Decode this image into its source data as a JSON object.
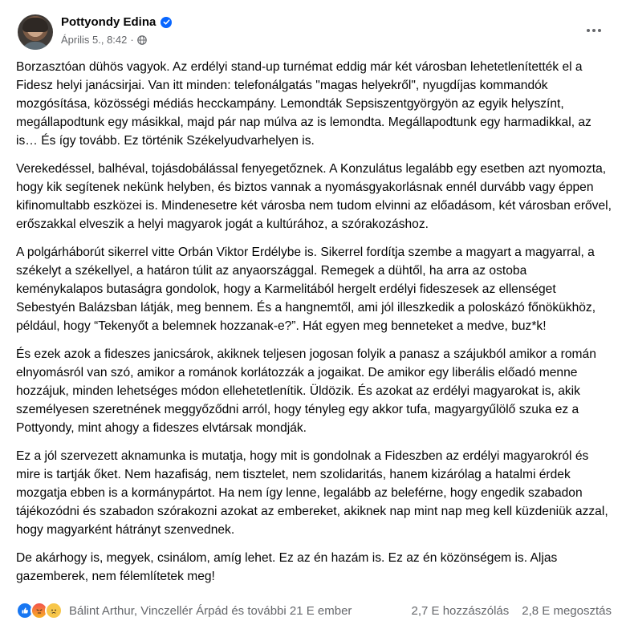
{
  "post": {
    "author": "Pottyondy Edina",
    "date": "Április 5., 8:42",
    "separator": "·",
    "paragraphs": [
      "Borzasztóan dühös vagyok. Az erdélyi stand-up turnémat eddig már két városban lehetetlenítették el a Fidesz helyi janácsirjai. Van itt minden: telefonálgatás \"magas helyekről\", nyugdíjas kommandók mozgósítása, közösségi médiás hecckampány. Lemondták Sepsiszentgyörgyön az egyik helyszínt, megállapodtunk egy másikkal, majd pár nap múlva az is lemondta. Megállapodtunk egy harmadikkal, az is… És így tovább. Ez történik Székelyudvarhelyen is.",
      "Verekedéssel, balhéval, tojásdobálással fenyegetőznek. A Konzulátus legalább egy esetben azt nyomozta, hogy kik segítenek nekünk helyben, és biztos vannak a nyomásgyakorlásnak ennél durvább vagy éppen kifinomultabb eszközei is. Mindenesetre két városba nem tudom elvinni az előadásom, két városban erővel, erőszakkal elveszik a helyi magyarok jogát a kultúrához, a szórakozáshoz.",
      "A polgárháborút sikerrel vitte Orbán Viktor Erdélybe is. Sikerrel fordítja szembe a magyart a magyarral, a székelyt a székellyel, a határon túlit az anyaországgal. Remegek a dühtől, ha arra az ostoba keménykalapos butaságra gondolok, hogy a Karmelitából hergelt erdélyi fideszesek az ellenséget Sebestyén Balázsban látják, meg bennem. És a hangnemtől, ami jól illeszkedik a poloskázó főnökükhöz, például, hogy “Tekenyőt a belemnek hozzanak-e?”. Hát egyen meg benneteket a medve, buz*k!",
      "És ezek azok a fideszes janicsárok, akiknek teljesen jogosan folyik a panasz a szájukból amikor a román elnyomásról van szó, amikor a románok korlátozzák a jogaikat. De amikor egy liberális előadó menne hozzájuk, minden lehetséges módon ellehetetlenítik. Üldözik. És azokat az erdélyi magyarokat is, akik személyesen szeretnének meggyőződni arról, hogy tényleg egy akkor tufa, magyargyűlölő szuka ez a Pottyondy, mint ahogy a fideszes elvtársak mondják.",
      "Ez a jól szervezett aknamunka is mutatja, hogy mit is gondolnak a Fideszben az erdélyi magyarokról és mire is tartják őket. Nem hazafiság, nem tisztelet, nem szolidaritás, hanem kizárólag a hatalmi érdek mozgatja ebben is a kormánypártot. Ha nem így lenne, legalább az beleférne, hogy engedik szabadon tájékozódni és szabadon szórakozni azokat az embereket, akiknek nap mint nap meg kell küzdeniük azzal, hogy magyarként hátrányt szenvednek.",
      "De akárhogy is, megyek, csinálom, amíg lehet. Ez az én hazám is. Ez az én közönségem is. Aljas gazemberek, nem félemlítetek meg!"
    ],
    "reactions": {
      "icons": [
        "like-icon",
        "angry-icon",
        "sad-icon"
      ],
      "names": "Bálint Arthur, Vinczellér Árpád és további 21 E ember",
      "comments": "2,7 E hozzászólás",
      "shares": "2,8 E megosztás"
    }
  }
}
